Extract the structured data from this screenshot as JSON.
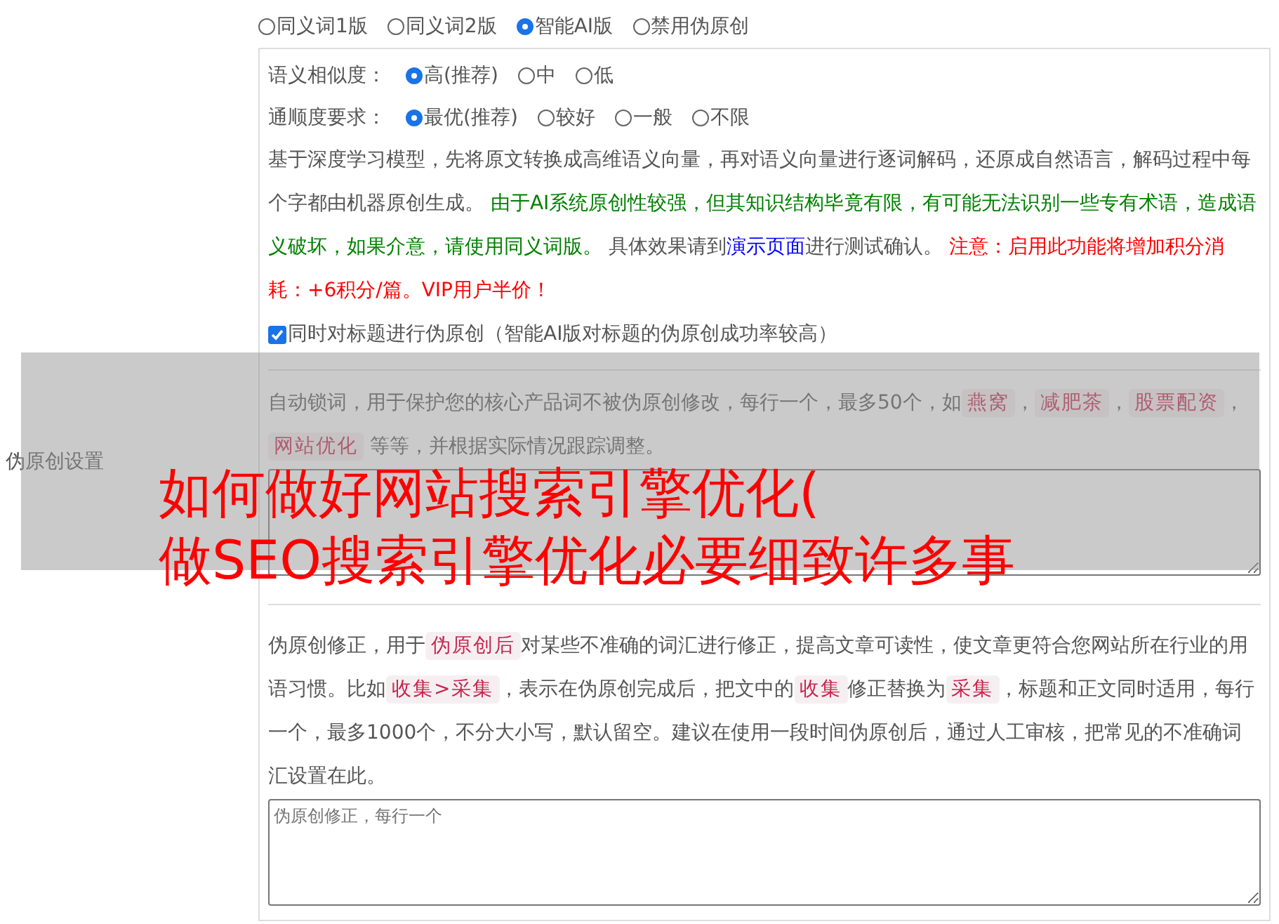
{
  "section_label": "伪原创设置",
  "modes": [
    {
      "label": "同义词1版",
      "selected": false
    },
    {
      "label": "同义词2版",
      "selected": false
    },
    {
      "label": "智能AI版",
      "selected": true
    },
    {
      "label": "禁用伪原创",
      "selected": false
    }
  ],
  "similarity": {
    "label": "语义相似度：",
    "options": [
      {
        "label": "高(推荐)",
        "selected": true
      },
      {
        "label": "中",
        "selected": false
      },
      {
        "label": "低",
        "selected": false
      }
    ]
  },
  "fluency": {
    "label": "通顺度要求：",
    "options": [
      {
        "label": "最优(推荐)",
        "selected": true
      },
      {
        "label": "较好",
        "selected": false
      },
      {
        "label": "一般",
        "selected": false
      },
      {
        "label": "不限",
        "selected": false
      }
    ]
  },
  "ai_description": [
    {
      "kind": "plain",
      "text": "基于深度学习模型，先将原文转换成高维语义向量，再对语义向量进行逐词解码，还原成自然语言，解码过程中每个字都由机器原创生成。 "
    },
    {
      "kind": "green",
      "text": "由于AI系统原创性较强，但其知识结构毕竟有限，有可能无法识别一些专有术语，造成语义破坏，如果介意，请使用同义词版。"
    },
    {
      "kind": "plain",
      "text": " 具体效果请到"
    },
    {
      "kind": "link",
      "text": "演示页面"
    },
    {
      "kind": "plain",
      "text": "进行测试确认。 "
    },
    {
      "kind": "red",
      "text": "注意：启用此功能将增加积分消耗：+6积分/篇。VIP用户半价！"
    }
  ],
  "title_option": {
    "label": "同时对标题进行伪原创（智能AI版对标题的伪原创成功率较高）",
    "checked": true
  },
  "lock_words_help": [
    {
      "kind": "plain",
      "text": "自动锁词，用于保护您的核心产品词不被伪原创修改，每行一个，最多50个，如"
    },
    {
      "kind": "tag",
      "text": "燕窝"
    },
    {
      "kind": "plain",
      "text": "，"
    },
    {
      "kind": "tag",
      "text": "减肥茶"
    },
    {
      "kind": "plain",
      "text": "，"
    },
    {
      "kind": "tag",
      "text": "股票配资"
    },
    {
      "kind": "plain",
      "text": "，"
    },
    {
      "kind": "tag",
      "text": "网站优化"
    },
    {
      "kind": "plain",
      "text": " 等等，并根据实际情况跟踪调整。"
    }
  ],
  "correction_help": [
    {
      "kind": "plain",
      "text": "伪原创修正，用于"
    },
    {
      "kind": "tag",
      "text": "伪原创后"
    },
    {
      "kind": "plain",
      "text": "对某些不准确的词汇进行修正，提高文章可读性，使文章更符合您网站所在行业的用语习惯。比如"
    },
    {
      "kind": "tag",
      "text": "收集>采集"
    },
    {
      "kind": "plain",
      "text": "，表示在伪原创完成后，把文中的"
    },
    {
      "kind": "tag",
      "text": "收集"
    },
    {
      "kind": "plain",
      "text": "修正替换为"
    },
    {
      "kind": "tag",
      "text": "采集"
    },
    {
      "kind": "plain",
      "text": "，标题和正文同时适用，每行一个，最多1000个，不分大小写，默认留空。建议在使用一段时间伪原创后，通过人工审核，把常见的不准确词汇设置在此。"
    }
  ],
  "correction_field": {
    "placeholder": "伪原创修正，每行一个"
  },
  "overlay_title": [
    "如何做好网站搜索引擎优化(",
    "做SEO搜索引擎优化必要细致许多事"
  ]
}
